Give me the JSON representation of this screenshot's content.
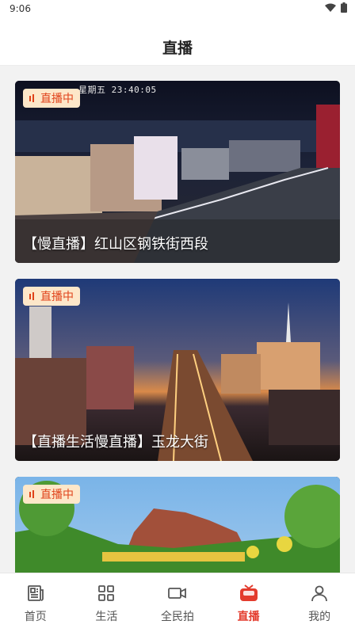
{
  "status_bar": {
    "time": "9:06"
  },
  "header": {
    "title": "直播"
  },
  "feed": {
    "items": [
      {
        "badge": "直播中",
        "title": "【慢直播】红山区钢铁街西段",
        "overlay": "星期五  23:40:05"
      },
      {
        "badge": "直播中",
        "title": "【直播生活慢直播】玉龙大街"
      },
      {
        "badge": "直播中",
        "title": ""
      }
    ]
  },
  "tabbar": {
    "tabs": [
      {
        "label": "首页",
        "icon": "news-icon"
      },
      {
        "label": "生活",
        "icon": "grid-icon"
      },
      {
        "label": "全民拍",
        "icon": "video-camera-icon"
      },
      {
        "label": "直播",
        "icon": "live-tv-icon",
        "active": true
      },
      {
        "label": "我的",
        "icon": "person-icon"
      }
    ]
  },
  "colors": {
    "accent": "#e33b2d",
    "badge_bg": "#fde7c9",
    "badge_text": "#e0421a"
  }
}
